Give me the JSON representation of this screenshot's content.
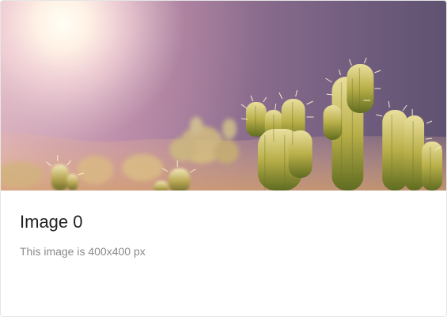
{
  "card": {
    "title": "Image 0",
    "description": "This image is 400x400 px"
  }
}
